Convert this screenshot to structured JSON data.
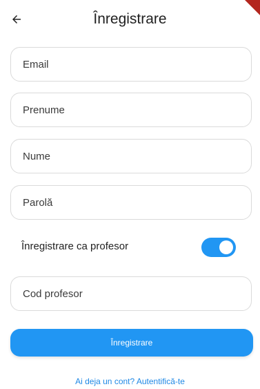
{
  "app_bar": {
    "title": "Înregistrare",
    "back_icon": "arrow-left-icon"
  },
  "form": {
    "email_placeholder": "Email",
    "first_name_placeholder": "Prenume",
    "last_name_placeholder": "Nume",
    "password_placeholder": "Parolă",
    "teacher_switch_label": "Înregistrare ca profesor",
    "teacher_switch_on": true,
    "teacher_code_placeholder": "Cod profesor"
  },
  "actions": {
    "register_label": "Înregistrare",
    "login_link": "Ai deja un cont? Autentifică-te"
  },
  "colors": {
    "accent": "#2196f3",
    "link": "#1e88e5",
    "debug_banner": "#b3261e"
  }
}
